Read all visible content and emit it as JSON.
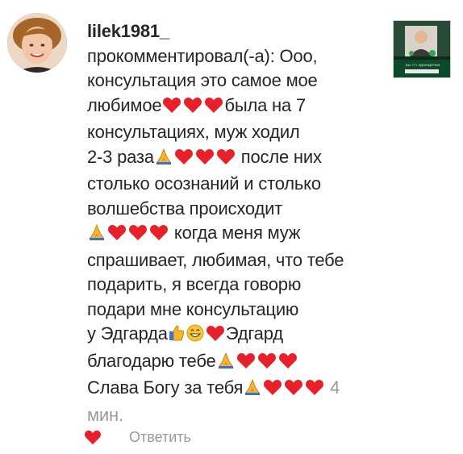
{
  "comment": {
    "username": "lilek1981_",
    "lines": [
      "прокомментировал(-а): Ооо,",
      "консультация это самое мое",
      "любимое",
      "была на 7",
      "консультациях, муж ходил",
      "2-3 раза",
      "после них",
      "столько осознаний и столько",
      "волшебства происходит",
      "когда меня муж",
      "спрашивает, любимая, что тебе",
      "подарить, я всегда говорю",
      "подари мне консультацию",
      "у Эдгарда",
      "Эдгард",
      "благодарю тебе",
      "Слава Богу за тебя"
    ],
    "time_number": "4",
    "time_unit": "мин."
  },
  "actions": {
    "reply_label": "Ответить"
  },
  "thumbnail": {
    "caption": "Ash 777 ЭДГАРДЕРЖИ"
  },
  "icons": {
    "avatar": "user-photo",
    "heart": "red-heart-emoji",
    "pray": "folded-hands-emoji",
    "thumbs": "thumbs-up-emoji",
    "grin": "grinning-face-emoji",
    "like": "like-heart-icon"
  },
  "colors": {
    "heart": "#e8202a",
    "time": "#9a9a9a",
    "text": "#262626"
  }
}
